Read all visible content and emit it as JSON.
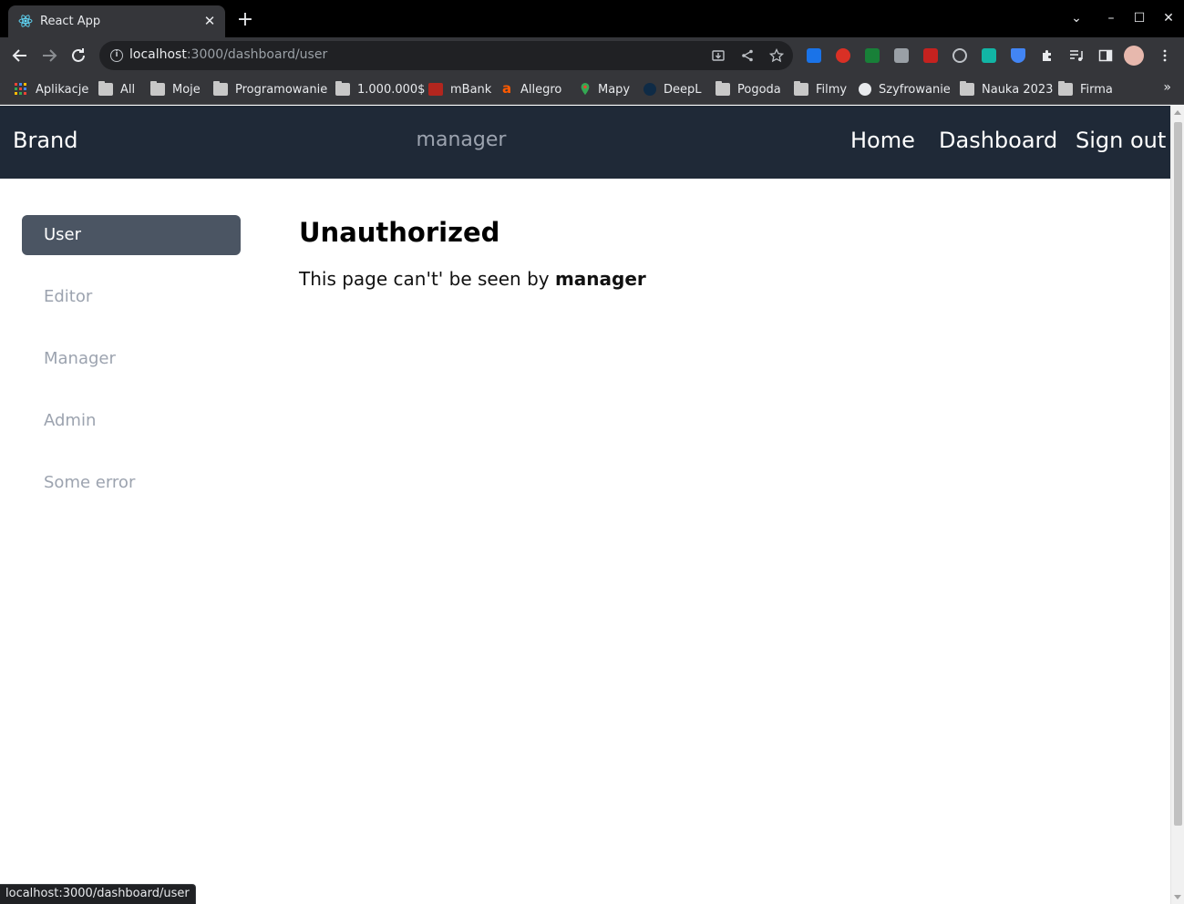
{
  "browser": {
    "tab_title": "React App",
    "tab_close": "✕",
    "new_tab": "+",
    "url_host": "localhost",
    "url_path": ":3000/dashboard/user",
    "bookmarks": [
      {
        "label": "Aplikacje",
        "icon": "apps-grid-icon"
      },
      {
        "label": "All",
        "icon": "folder-icon"
      },
      {
        "label": "Moje",
        "icon": "folder-icon"
      },
      {
        "label": "Programowanie",
        "icon": "folder-icon"
      },
      {
        "label": "1.000.000$",
        "icon": "folder-icon"
      },
      {
        "label": "mBank",
        "icon": "mbank-icon"
      },
      {
        "label": "Allegro",
        "icon": "allegro-icon"
      },
      {
        "label": "Mapy",
        "icon": "maps-pin-icon"
      },
      {
        "label": "DeepL",
        "icon": "deepl-icon"
      },
      {
        "label": "Pogoda",
        "icon": "folder-icon"
      },
      {
        "label": "Filmy",
        "icon": "folder-icon"
      },
      {
        "label": "Szyfrowanie",
        "icon": "globe-icon"
      },
      {
        "label": "Nauka 2023",
        "icon": "folder-icon"
      },
      {
        "label": "Firma",
        "icon": "folder-icon"
      }
    ],
    "bookmarks_overflow": "»",
    "status_url": "localhost:3000/dashboard/user"
  },
  "navbar": {
    "brand": "Brand",
    "role": "manager",
    "links": [
      "Home",
      "Dashboard",
      "Sign out"
    ]
  },
  "sidebar": {
    "items": [
      {
        "label": "User",
        "active": true
      },
      {
        "label": "Editor",
        "active": false
      },
      {
        "label": "Manager",
        "active": false
      },
      {
        "label": "Admin",
        "active": false
      },
      {
        "label": "Some error",
        "active": false
      }
    ]
  },
  "main": {
    "title": "Unauthorized",
    "message_prefix": "This page can't' be seen by ",
    "message_role": "manager"
  },
  "colors": {
    "navbar_bg": "#1f2937",
    "sidebar_active_bg": "#4b5563",
    "muted_text": "#9ca3af"
  }
}
